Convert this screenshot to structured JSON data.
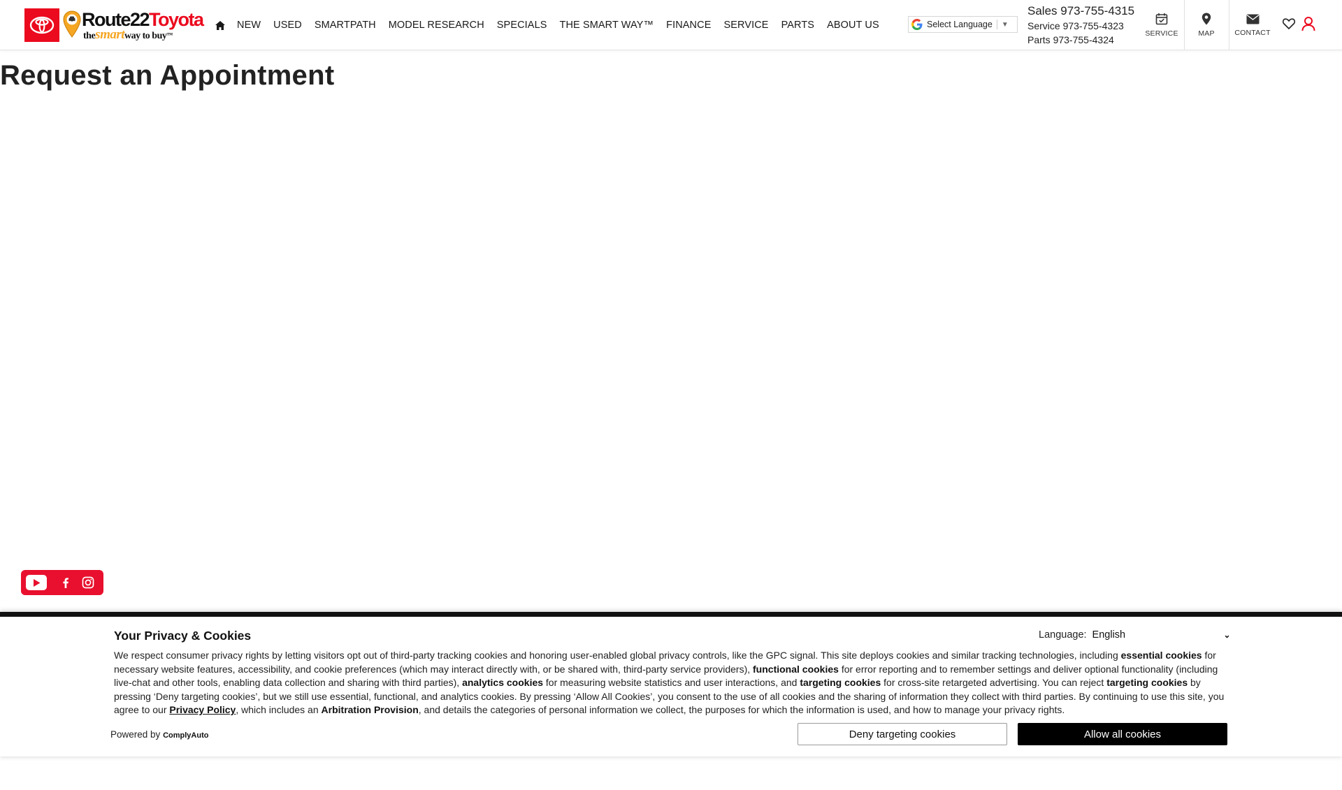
{
  "header": {
    "brand": {
      "word1": "Route22",
      "word2": "Toyota",
      "tag_pre": "the",
      "tag_smart": "smart",
      "tag_post": "way to buy",
      "tag_tm": "™"
    },
    "nav": [
      {
        "label": "NEW"
      },
      {
        "label": "USED"
      },
      {
        "label": "SMARTPATH"
      },
      {
        "label": "MODEL RESEARCH"
      },
      {
        "label": "SPECIALS"
      },
      {
        "label": "THE SMART WAY™"
      },
      {
        "label": "FINANCE"
      },
      {
        "label": "SERVICE"
      },
      {
        "label": "PARTS"
      },
      {
        "label": "ABOUT US"
      }
    ],
    "translate": {
      "label": "Select Language",
      "arrow": "▼"
    },
    "phones": {
      "sales_label": "Sales",
      "sales_number": "973-755-4315",
      "service_label": "Service",
      "service_number": "973-755-4323",
      "parts_label": "Parts",
      "parts_number": "973-755-4324"
    },
    "utility": {
      "service": "SERVICE",
      "map": "MAP",
      "contact": "CONTACT"
    },
    "icons": [
      "home-icon",
      "calendar-check-icon",
      "map-pin-icon",
      "envelope-icon",
      "heart-icon",
      "user-icon"
    ]
  },
  "main": {
    "title": "Request an Appointment"
  },
  "social": {
    "icons": [
      "youtube-icon",
      "facebook-icon",
      "instagram-icon"
    ]
  },
  "cookie_banner": {
    "title": "Your Privacy & Cookies",
    "language_label": "Language:",
    "language_value": "English",
    "text": {
      "p1": "We respect consumer privacy rights by letting visitors opt out of third-party tracking cookies and honoring user-enabled global privacy controls, like the GPC signal. This site deploys cookies and similar tracking technologies, including ",
      "essential": "essential cookies",
      "p2": " for necessary website features, accessibility, and cookie preferences (which may interact directly with, or be shared with, third-party service providers), ",
      "functional": "functional cookies",
      "p3": " for error reporting and to remember settings and deliver optional functionality (including live-chat and other tools, enabling data collection and sharing with third parties), ",
      "analytics": "analytics cookies",
      "p4": " for measuring website statistics and user interactions, and ",
      "targeting": "targeting cookies",
      "p5": " for cross-site retargeted advertising. You can reject ",
      "targeting2": "targeting cookies",
      "p6": " by pressing ‘Deny targeting cookies’, but we still use essential, functional, and analytics cookies. By pressing ‘Allow All Cookies’, you consent to the use of all cookies and the sharing of information they collect with third parties. By continuing to use this site, you agree to our ",
      "privacy_link": "Privacy Policy",
      "p7": ", which includes an ",
      "arbitration": "Arbitration Provision",
      "p8": ", and details the categories of personal information we collect, the purposes for which the information is used, and how to manage your privacy rights."
    },
    "powered_label": "Powered by",
    "powered_brand": "ComplyAuto",
    "deny_button": "Deny targeting cookies",
    "allow_button": "Allow all cookies"
  },
  "colors": {
    "brand_red": "#eb0a1e",
    "accent_orange": "#f5a623",
    "social_red": "#e8102e",
    "text": "#222222",
    "banner_border": "#111111"
  }
}
